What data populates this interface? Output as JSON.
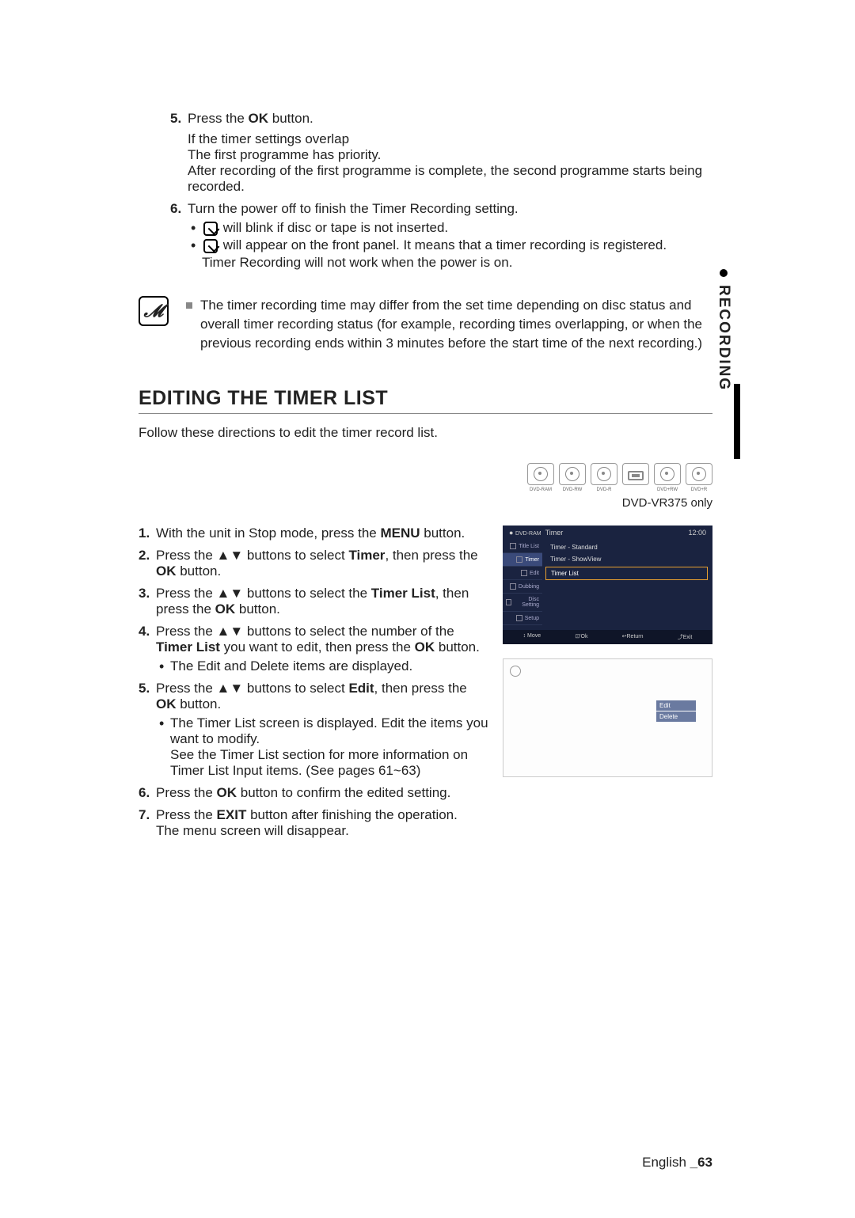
{
  "side_tab": "RECORDING",
  "steps_a": [
    {
      "num": "5.",
      "text_prefix": "Press the ",
      "bold": "OK",
      "text_suffix": " button.",
      "sub_lines": [
        "If the timer settings overlap",
        "The first programme has priority.",
        "After recording of the first programme is complete, the second programme starts being recorded."
      ]
    },
    {
      "num": "6.",
      "text": "Turn the power off to finish the Timer Recording setting.",
      "bullets": [
        {
          "before_icon": "",
          "after_icon": " will blink if disc or tape is not inserted."
        },
        {
          "before_icon": "",
          "after_icon": " will appear on the front panel. It means that a timer recording is registered.",
          "extra": "Timer Recording will not work when the power is on."
        }
      ]
    }
  ],
  "note_text": "The timer recording time may differ from the set time depending on disc status and overall timer recording status (for example, recording times overlapping, or when the previous recording ends within 3 minutes before the start time of the next recording.)",
  "section_title": "EDITING THE TIMER LIST",
  "section_sub": "Follow these directions to edit the timer record list.",
  "discs": [
    "DVD-RAM",
    "DVD-RW",
    "DVD-R",
    "",
    "DVD+RW",
    "DVD+R"
  ],
  "model_note": "DVD-VR375 only",
  "steps_b": [
    {
      "num": "1.",
      "parts": [
        "With the unit in Stop mode, press the ",
        "MENU",
        " button."
      ]
    },
    {
      "num": "2.",
      "parts": [
        "Press the ▲▼ buttons to select ",
        "Timer",
        ", then press the ",
        "OK",
        " button."
      ]
    },
    {
      "num": "3.",
      "parts": [
        "Press the ▲▼ buttons to select the ",
        "Timer List",
        ", then press the ",
        "OK",
        " button."
      ]
    },
    {
      "num": "4.",
      "parts": [
        "Press the ▲▼ buttons to select the number of the ",
        "Timer List",
        " you want to edit, then press the ",
        "OK",
        " button."
      ],
      "bullets": [
        "The Edit and Delete items are displayed."
      ]
    },
    {
      "num": "5.",
      "parts": [
        "Press the ▲▼ buttons to select ",
        "Edit",
        ", then press the ",
        "OK",
        " button."
      ],
      "bullets": [
        "The Timer List screen is displayed. Edit the items you want to modify.",
        "See the Timer List section for more information on Timer List Input items. (See pages 61~63)"
      ]
    },
    {
      "num": "6.",
      "parts": [
        "Press the ",
        "OK",
        " button to confirm the edited setting."
      ]
    },
    {
      "num": "7.",
      "parts": [
        "Press the ",
        "EXIT",
        " button after finishing the operation.",
        "The menu screen will disappear."
      ]
    }
  ],
  "mockup1": {
    "header_left": "Timer",
    "header_disc": "DVD-RAM",
    "time": "12:00",
    "side_items": [
      "Title List",
      "Timer",
      "Edit",
      "Dubbing",
      "Disc Setting",
      "Setup"
    ],
    "main_items": [
      "Timer - Standard",
      "Timer - ShowView",
      "Timer List"
    ],
    "footer": [
      "↕ Move",
      "⊡'Ok",
      "↩Return",
      "⤴Exit"
    ]
  },
  "mockup2": {
    "menu": [
      "Edit",
      "Delete"
    ]
  },
  "footer": {
    "lang": "English ",
    "page": "_63"
  }
}
